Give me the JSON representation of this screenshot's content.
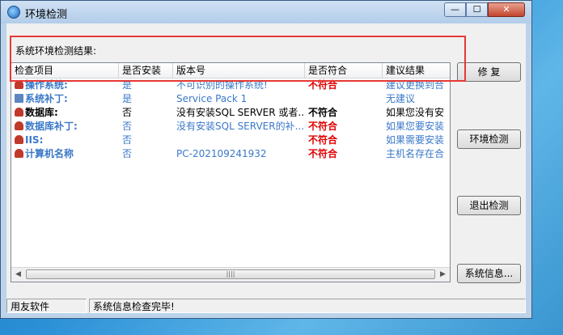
{
  "window": {
    "title": "环境检测",
    "controls": {
      "minimize": "—",
      "maximize": "☐",
      "close": "✕"
    }
  },
  "section_label": "系统环境检测结果:",
  "list": {
    "columns": [
      "检查项目",
      "是否安装",
      "版本号",
      "是否符合",
      "建议结果"
    ],
    "rows": [
      {
        "item": "操作系统:",
        "installed": "是",
        "version": "不可识别的操作系统!",
        "compliant": "不符合",
        "advice": "建议更换到合",
        "style": "blue",
        "icon": "alarm-icon"
      },
      {
        "item": "系统补丁:",
        "installed": "是",
        "version": "Service Pack 1",
        "compliant": "",
        "advice": "无建议",
        "style": "blue",
        "icon": "service-pack-icon"
      },
      {
        "item": "数据库:",
        "installed": "否",
        "version": "没有安装SQL SERVER 或者...",
        "compliant": "不符合",
        "advice": "如果您没有安",
        "style": "dark",
        "icon": "alarm-icon"
      },
      {
        "item": "数据库补丁:",
        "installed": "否",
        "version": "没有安装SQL SERVER的补...",
        "compliant": "不符合",
        "advice": "如果您要安装",
        "style": "blue",
        "icon": "alarm-icon"
      },
      {
        "item": "IIS:",
        "installed": "否",
        "version": "",
        "compliant": "不符合",
        "advice": "如果需要安装",
        "style": "blue",
        "icon": "alarm-icon"
      },
      {
        "item": "计算机名称",
        "installed": "否",
        "version": "PC-202109241932",
        "compliant": "不符合",
        "advice": "主机名存在合",
        "style": "blue",
        "icon": "alarm-icon"
      }
    ],
    "scroll_thumb_grip": "||||"
  },
  "buttons": {
    "repair": "修 复",
    "env_check": "环境检测",
    "exit_check": "退出检测",
    "system_info": "系统信息..."
  },
  "status": {
    "left": "用友软件",
    "message": "系统信息检查完毕!"
  },
  "colors": {
    "highlight_border": "#e53935",
    "fail_text": "#e00000",
    "link_blue": "#3a78c8"
  }
}
